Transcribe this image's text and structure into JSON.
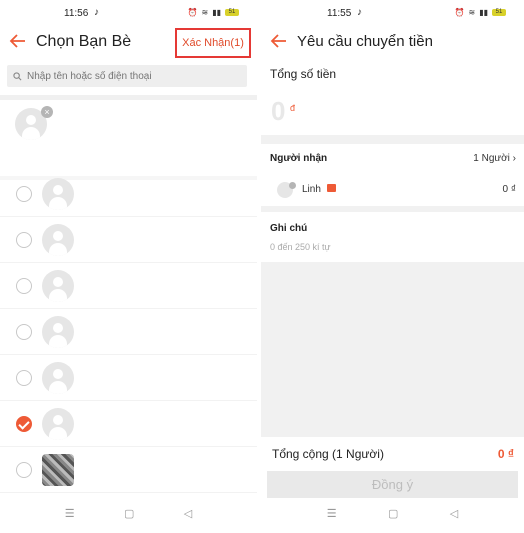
{
  "left": {
    "status": {
      "time": "11:56",
      "battery": "51"
    },
    "header": {
      "title": "Chọn Bạn Bè",
      "confirm_label": "Xác Nhận(1)"
    },
    "search": {
      "placeholder": "Nhập tên hoặc số điện thoại"
    },
    "friends": [
      {
        "checked": false,
        "avatar": "default"
      },
      {
        "checked": false,
        "avatar": "default"
      },
      {
        "checked": false,
        "avatar": "default"
      },
      {
        "checked": false,
        "avatar": "default"
      },
      {
        "checked": false,
        "avatar": "default"
      },
      {
        "checked": true,
        "avatar": "default"
      },
      {
        "checked": false,
        "avatar": "photo"
      }
    ],
    "nav": {
      "menu": "☰",
      "home": "▢",
      "back": "◁"
    }
  },
  "right": {
    "status": {
      "time": "11:55",
      "battery": "51"
    },
    "header": {
      "title": "Yêu cầu chuyển tiền"
    },
    "total_amount_label": "Tổng số tiền",
    "total_amount_value": "0",
    "currency": "đ",
    "recipients_label": "Người nhận",
    "recipients_count": "1 Người",
    "recipient": {
      "name": "Linh",
      "amount": "0 ₫"
    },
    "note_label": "Ghi chú",
    "note_hint": "0 đến 250 kí tự",
    "summary_label": "Tổng cộng (1 Người)",
    "summary_amount": "0 ₫",
    "agree_label": "Đồng ý",
    "nav": {
      "menu": "☰",
      "home": "▢",
      "back": "◁"
    }
  },
  "colors": {
    "accent": "#ee5a36",
    "highlight_border": "#e53935"
  }
}
